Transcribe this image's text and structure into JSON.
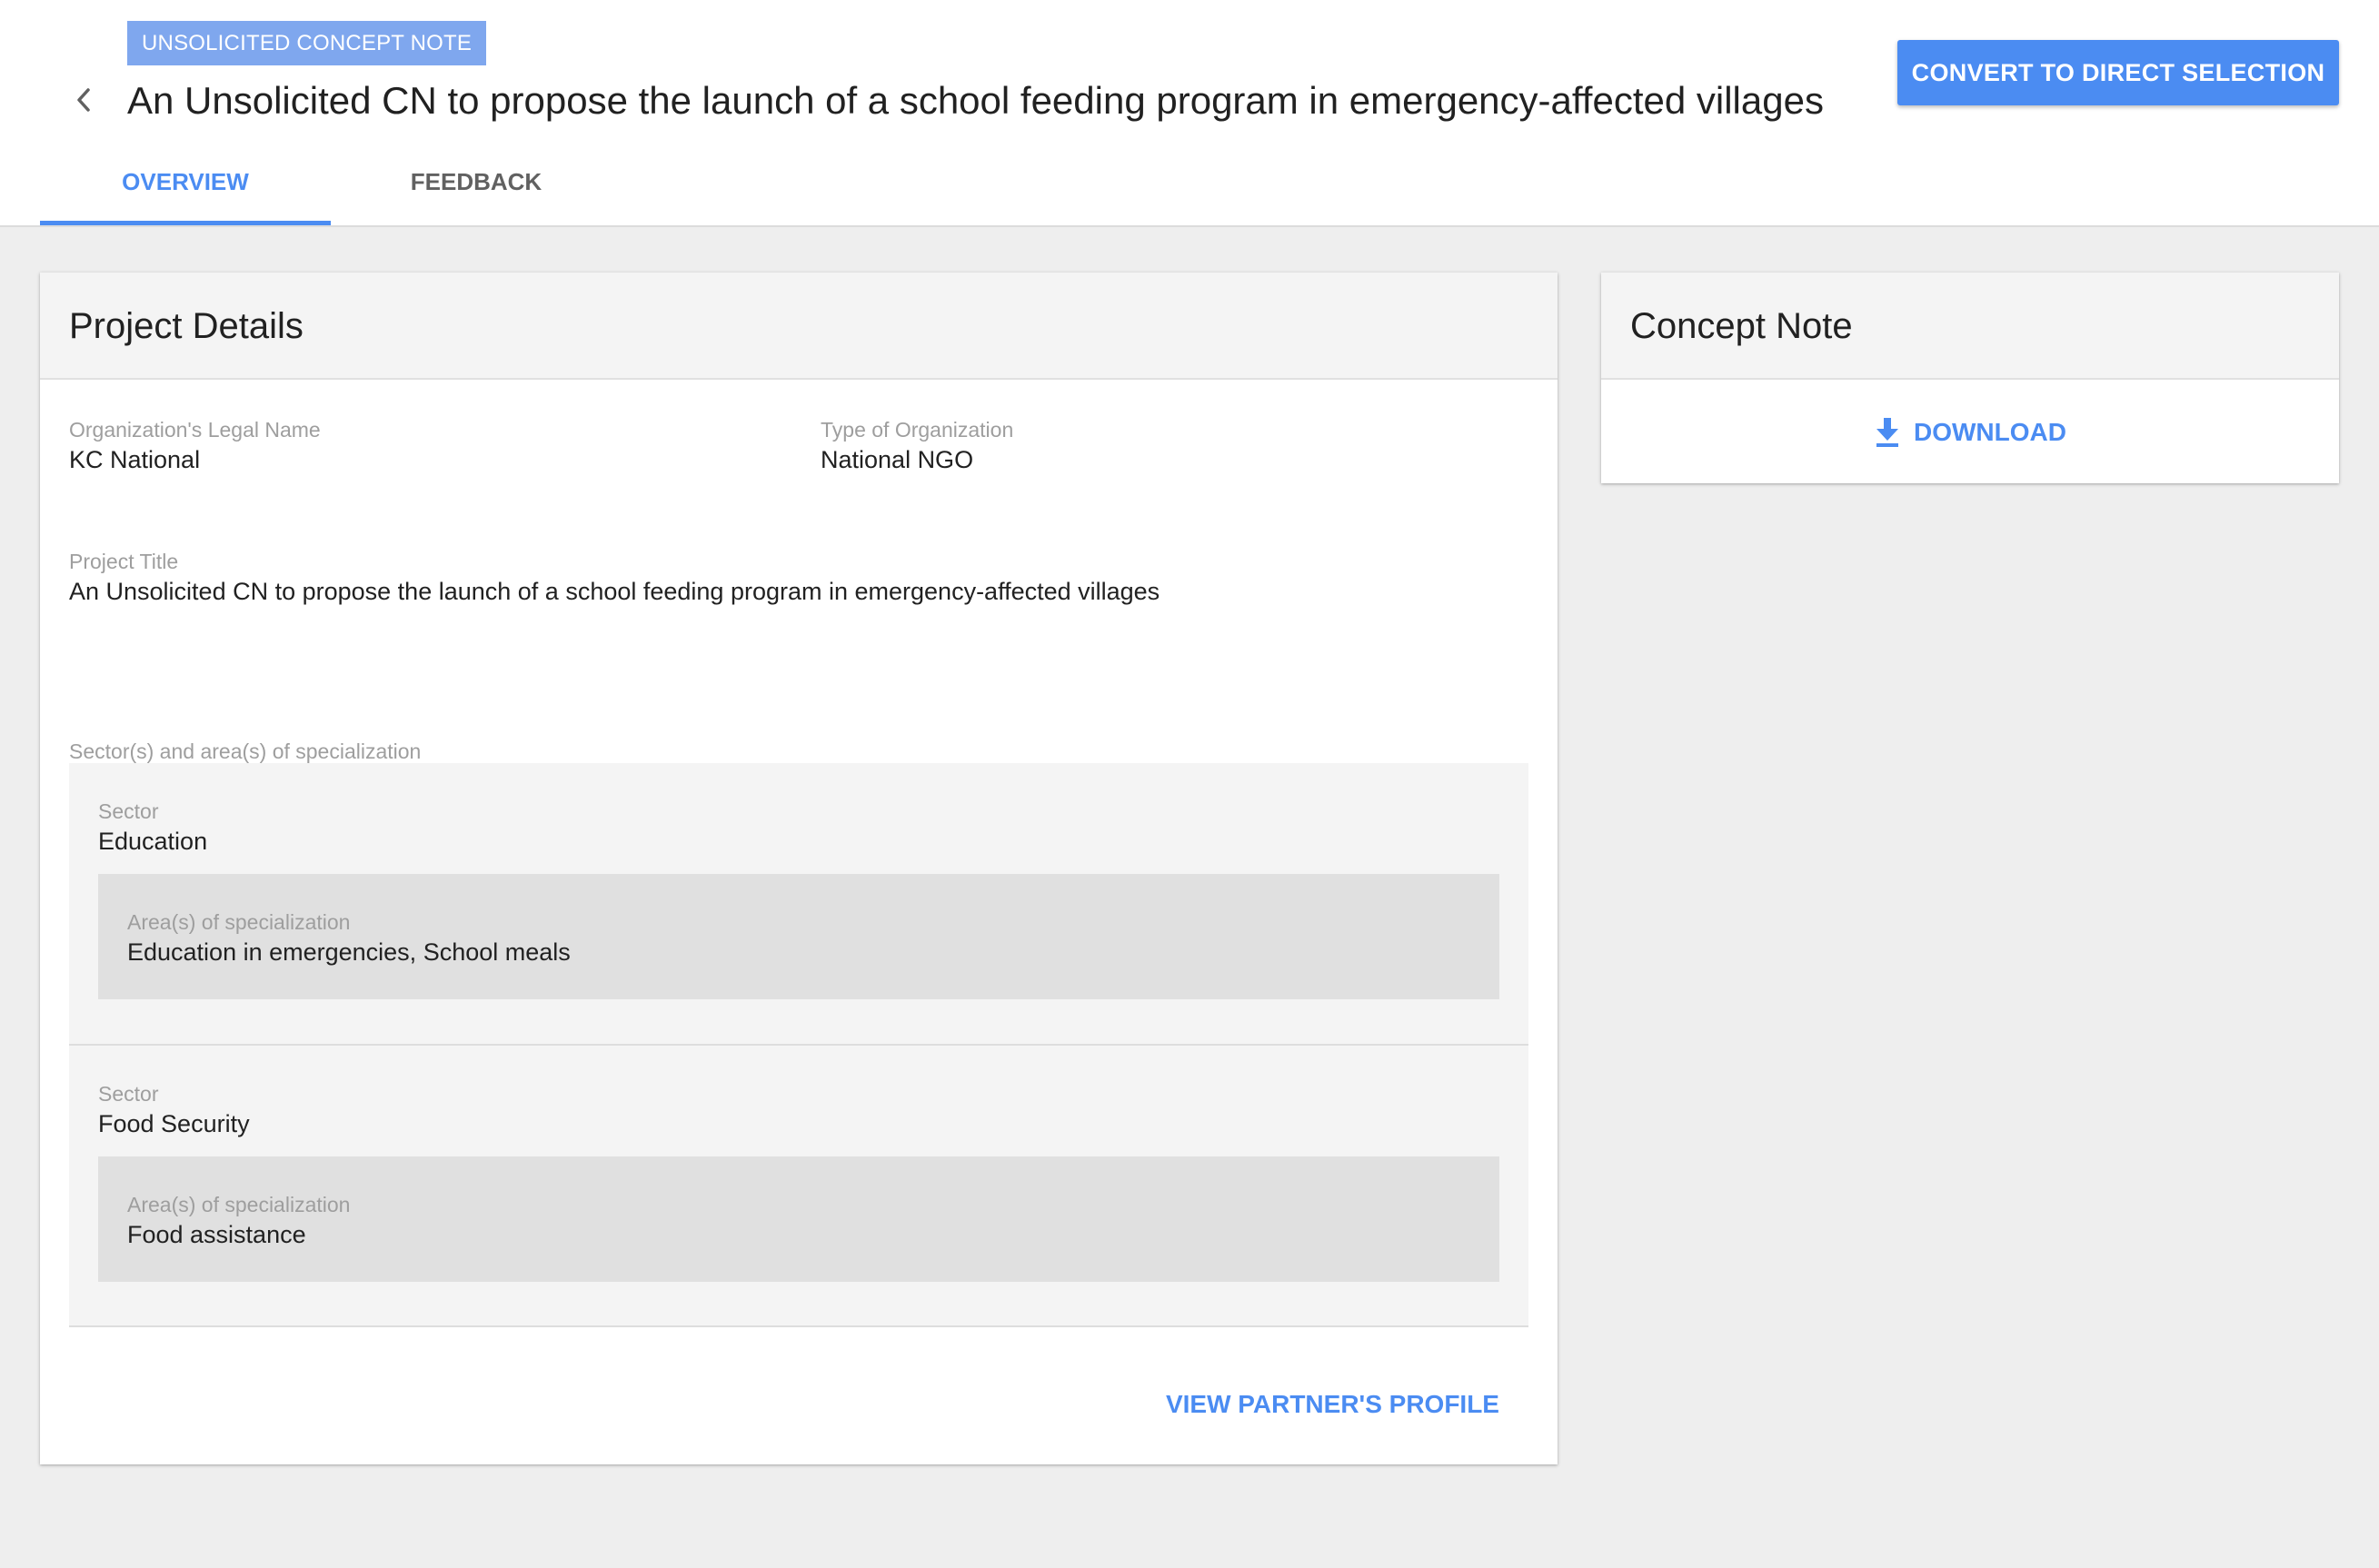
{
  "header": {
    "badge": "UNSOLICITED CONCEPT NOTE",
    "title": "An Unsolicited CN to propose the launch of a school feeding program in emergency-affected villages",
    "convert_button": "CONVERT TO DIRECT SELECTION",
    "tabs": [
      {
        "label": "OVERVIEW",
        "active": true
      },
      {
        "label": "FEEDBACK",
        "active": false
      }
    ]
  },
  "project_details": {
    "heading": "Project Details",
    "org_legal_name": {
      "label": "Organization's Legal Name",
      "value": "KC National"
    },
    "org_type": {
      "label": "Type of Organization",
      "value": "National NGO"
    },
    "project_title": {
      "label": "Project Title",
      "value": "An Unsolicited CN to propose the launch of a school feeding program in emergency-affected villages"
    },
    "sectors_label": "Sector(s) and area(s) of specialization",
    "sectors": [
      {
        "sector_label": "Sector",
        "sector": "Education",
        "areas_label": "Area(s) of specialization",
        "areas": "Education in emergencies, School meals"
      },
      {
        "sector_label": "Sector",
        "sector": "Food Security",
        "areas_label": "Area(s) of specialization",
        "areas": "Food assistance"
      }
    ],
    "profile_link": "VIEW PARTNER'S PROFILE"
  },
  "concept_note": {
    "heading": "Concept Note",
    "download_label": "DOWNLOAD",
    "download_icon": "download-icon"
  },
  "colors": {
    "accent": "#4b8cf2",
    "badge": "#7fa7ee",
    "background": "#eeeeee"
  }
}
